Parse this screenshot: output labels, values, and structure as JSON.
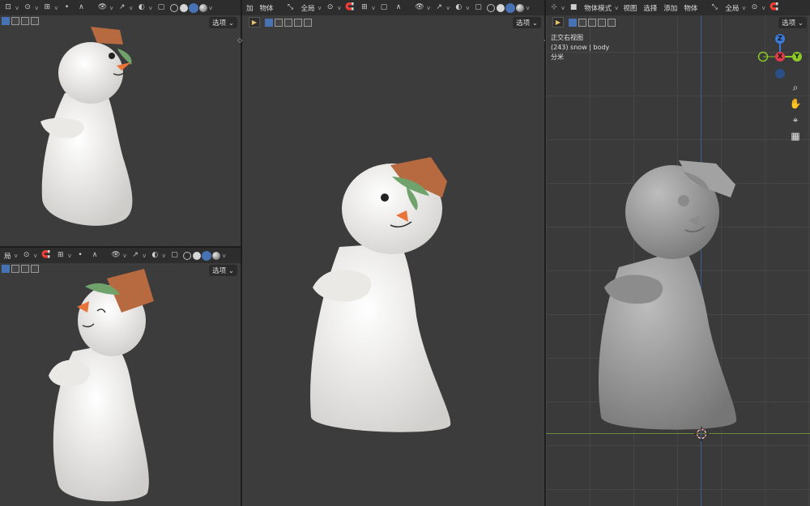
{
  "viewports": {
    "top_left": {
      "options_label": "选项"
    },
    "bottom_left": {
      "header_fragment": "局",
      "options_label": "选项"
    },
    "center": {
      "menu": [
        "加",
        "物体"
      ],
      "transform_space": "全局",
      "options_label": "选项"
    },
    "right": {
      "mode": "物体模式",
      "menu": [
        "视图",
        "选择",
        "添加",
        "物体"
      ],
      "transform_space": "全局",
      "options_label": "选项",
      "info": {
        "view_name": "正交右视图",
        "object_line": "(243) snow | body",
        "units": "分米"
      },
      "gizmo_axes": {
        "z": "Z",
        "y": "Y",
        "x": "X"
      }
    }
  },
  "colors": {
    "viewport_bg": "#3c3c3c",
    "header_bg": "#2d2d2d",
    "accent": "#4772b3",
    "gizmo_x": "#e03b4b",
    "gizmo_y": "#8ac926",
    "gizmo_z": "#3a7ad6",
    "hat": "#b7693f",
    "leaf": "#6fa36b",
    "carrot": "#e8743a",
    "snow_body": "#f0eeeb",
    "clay": "#9c9c9c"
  },
  "icons": [
    "cursor-select-icon",
    "transform-icon",
    "magnet-icon",
    "proportional-icon",
    "eye-icon",
    "gizmo-icon",
    "overlay-icon",
    "xray-icon",
    "zoom-icon",
    "hand-pan-icon",
    "camera-icon",
    "grid-icon"
  ]
}
